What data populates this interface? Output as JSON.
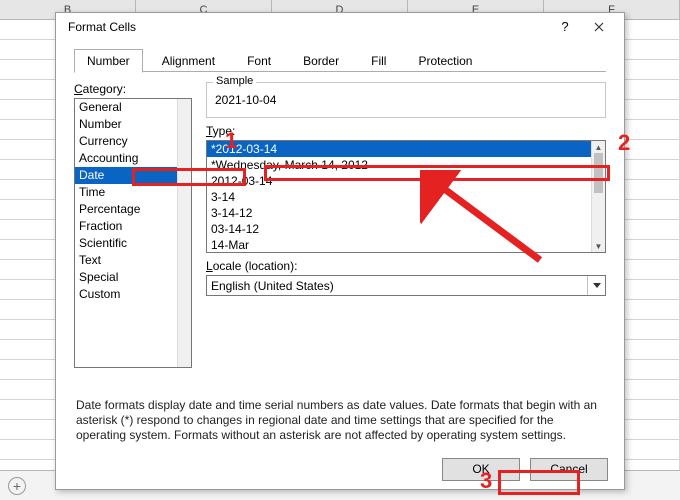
{
  "columns": [
    "B",
    "C",
    "D",
    "E",
    "F"
  ],
  "dialog": {
    "title": "Format Cells",
    "tabs": [
      "Number",
      "Alignment",
      "Font",
      "Border",
      "Fill",
      "Protection"
    ],
    "active_tab": 0,
    "category_label_pre": "C",
    "category_label_rest": "ategory:",
    "categories": [
      "General",
      "Number",
      "Currency",
      "Accounting",
      "Date",
      "Time",
      "Percentage",
      "Fraction",
      "Scientific",
      "Text",
      "Special",
      "Custom"
    ],
    "category_selected": 4,
    "sample_label": "Sample",
    "sample_value": "2021-10-04",
    "type_label_pre": "T",
    "type_label_rest": "ype:",
    "type_items": [
      "*2012-03-14",
      "*Wednesday, March 14, 2012",
      "2012-03-14",
      "3-14",
      "3-14-12",
      "03-14-12",
      "14-Mar"
    ],
    "type_selected": 0,
    "locale_label_pre": "L",
    "locale_label_rest": "ocale (location):",
    "locale_value": "English (United States)",
    "description": "Date formats display date and time serial numbers as date values.  Date formats that begin with an asterisk (*) respond to changes in regional date and time settings that are specified for the operating system. Formats without an asterisk are not affected by operating system settings.",
    "ok_label": "OK",
    "cancel_label": "Cancel"
  },
  "annotations": {
    "n1": "1",
    "n2": "2",
    "n3": "3"
  }
}
